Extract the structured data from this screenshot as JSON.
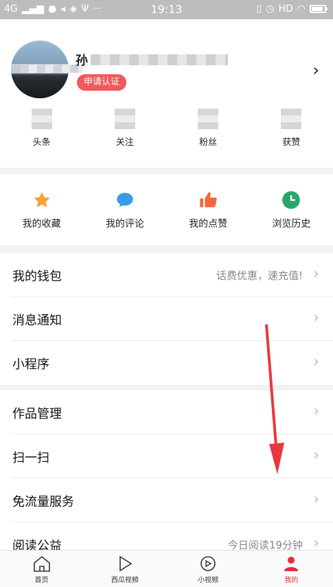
{
  "status_bar": {
    "network": "4G",
    "time": "19:13",
    "hd": "HD"
  },
  "profile": {
    "name_visible": "孙",
    "verify_button": "申请认证",
    "stats": [
      {
        "label": "头条"
      },
      {
        "label": "关注"
      },
      {
        "label": "粉丝"
      },
      {
        "label": "获赞"
      }
    ]
  },
  "quick_actions": [
    {
      "label": "我的收藏",
      "icon": "star-icon",
      "color": "#f5a03a"
    },
    {
      "label": "我的评论",
      "icon": "comment-icon",
      "color": "#3a9be8"
    },
    {
      "label": "我的点赞",
      "icon": "thumbs-up-icon",
      "color": "#f06a3a"
    },
    {
      "label": "浏览历史",
      "icon": "clock-icon",
      "color": "#2aa56e"
    }
  ],
  "menu_group1": [
    {
      "label": "我的钱包",
      "hint": "话费优惠，速充值!"
    },
    {
      "label": "消息通知",
      "hint": ""
    },
    {
      "label": "小程序",
      "hint": ""
    }
  ],
  "menu_group2": [
    {
      "label": "作品管理",
      "hint": ""
    },
    {
      "label": "扫一扫",
      "hint": ""
    },
    {
      "label": "免流量服务",
      "hint": ""
    },
    {
      "label": "阅读公益",
      "hint": "今日阅读19分钟"
    }
  ],
  "tabbar": [
    {
      "label": "首页",
      "icon": "home-icon"
    },
    {
      "label": "西瓜视频",
      "icon": "play-icon"
    },
    {
      "label": "小视频",
      "icon": "small-video-icon"
    },
    {
      "label": "我的",
      "icon": "profile-icon",
      "active": true
    }
  ],
  "colors": {
    "accent": "#e0303a",
    "verify": "#f05a5a"
  }
}
